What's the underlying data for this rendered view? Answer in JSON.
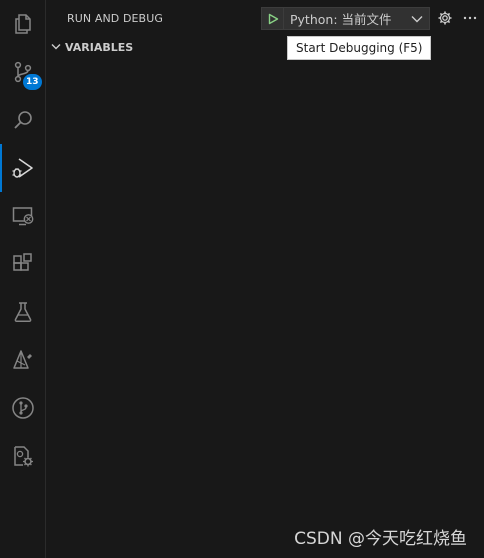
{
  "sidebar": {
    "title": "RUN AND DEBUG",
    "config": {
      "selected": "Python: 当前文件"
    },
    "tooltip": "Start Debugging (F5)",
    "sections": [
      {
        "title": "VARIABLES",
        "expanded": true
      }
    ]
  },
  "activity_bar": {
    "items": [
      {
        "name": "explorer",
        "icon": "files-icon"
      },
      {
        "name": "source-control",
        "icon": "source-control-icon",
        "badge": "13"
      },
      {
        "name": "search",
        "icon": "search-icon"
      },
      {
        "name": "run-and-debug",
        "icon": "run-debug-icon",
        "active": true
      },
      {
        "name": "remote-explorer",
        "icon": "remote-explorer-icon"
      },
      {
        "name": "extensions",
        "icon": "extensions-icon"
      },
      {
        "name": "testing",
        "icon": "beaker-icon"
      },
      {
        "name": "extension-tree",
        "icon": "extension-icon"
      },
      {
        "name": "git-graph",
        "icon": "git-graph-icon"
      },
      {
        "name": "settings-sync",
        "icon": "file-settings-icon"
      }
    ]
  },
  "watermark": "CSDN @今天吃红烧鱼",
  "colors": {
    "background": "#181818",
    "accent": "#0078d4",
    "play_green": "#89d185",
    "text": "#cccccc"
  }
}
